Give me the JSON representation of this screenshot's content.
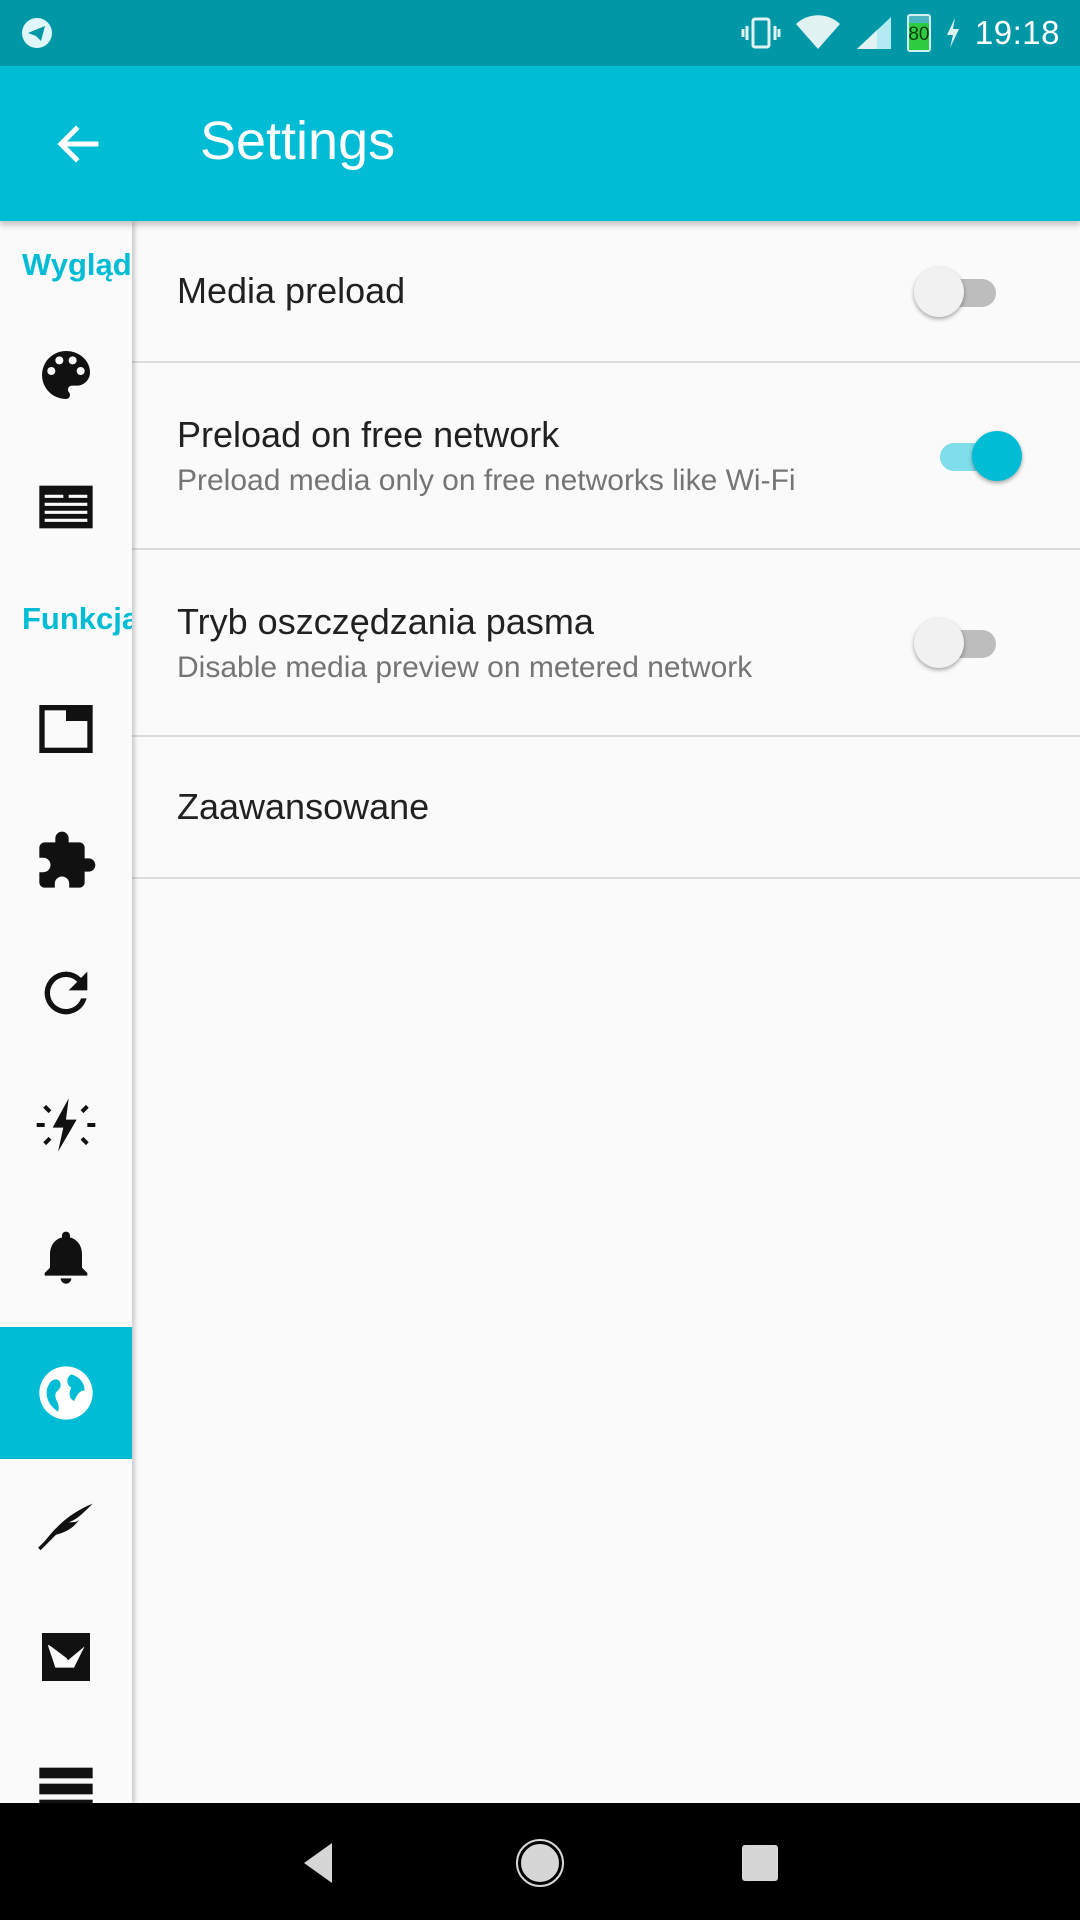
{
  "status_bar": {
    "time": "19:18",
    "battery_percent": "80",
    "icons": [
      "telegram-icon",
      "vibrate-icon",
      "wifi-icon",
      "cell-signal-icon",
      "battery-icon",
      "charging-icon"
    ]
  },
  "app_bar": {
    "title": "Settings",
    "back_icon": "arrow-back-icon"
  },
  "sidebar": {
    "sections": [
      {
        "label": "Wygląd"
      },
      {
        "label": "Funkcja"
      }
    ],
    "items": [
      {
        "icon": "palette-icon",
        "active": false
      },
      {
        "icon": "article-icon",
        "active": false
      },
      {
        "icon": "window-icon",
        "active": false
      },
      {
        "icon": "puzzle-icon",
        "active": false
      },
      {
        "icon": "refresh-icon",
        "active": false
      },
      {
        "icon": "flash-icon",
        "active": false
      },
      {
        "icon": "bell-icon",
        "active": false
      },
      {
        "icon": "globe-icon",
        "active": true
      },
      {
        "icon": "quill-icon",
        "active": false
      },
      {
        "icon": "bird-image-icon",
        "active": false
      },
      {
        "icon": "storage-icon",
        "active": false
      }
    ],
    "accent_color": "#00bcd4"
  },
  "preferences": [
    {
      "title": "Media preload",
      "summary": "",
      "switch": false
    },
    {
      "title": "Preload on free network",
      "summary": "Preload media only on free networks like Wi-Fi",
      "switch": true
    },
    {
      "title": "Tryb oszczędzania pasma",
      "summary": "Disable media preview on metered network",
      "switch": false
    },
    {
      "title": "Zaawansowane",
      "summary": ""
    }
  ],
  "nav_bar": {
    "icons": [
      "back-triangle-icon",
      "home-circle-icon",
      "recents-square-icon"
    ]
  },
  "colors": {
    "status_bar": "#0097a7",
    "app_bar": "#00bcd4",
    "background": "#fafafa"
  }
}
